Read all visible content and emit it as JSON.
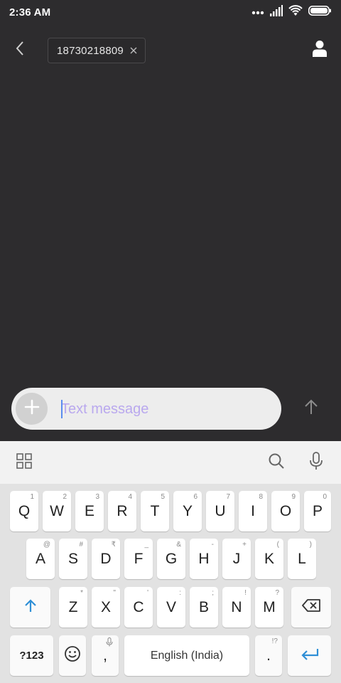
{
  "status_bar": {
    "time": "2:36 AM"
  },
  "header": {
    "recipient": "18730218809"
  },
  "compose": {
    "placeholder": "Text message"
  },
  "keyboard": {
    "row1": [
      {
        "label": "Q",
        "hint": "1"
      },
      {
        "label": "W",
        "hint": "2"
      },
      {
        "label": "E",
        "hint": "3"
      },
      {
        "label": "R",
        "hint": "4"
      },
      {
        "label": "T",
        "hint": "5"
      },
      {
        "label": "Y",
        "hint": "6"
      },
      {
        "label": "U",
        "hint": "7"
      },
      {
        "label": "I",
        "hint": "8"
      },
      {
        "label": "O",
        "hint": "9"
      },
      {
        "label": "P",
        "hint": "0"
      }
    ],
    "row2": [
      {
        "label": "A",
        "hint": "@"
      },
      {
        "label": "S",
        "hint": "#"
      },
      {
        "label": "D",
        "hint": "₹"
      },
      {
        "label": "F",
        "hint": "_"
      },
      {
        "label": "G",
        "hint": "&"
      },
      {
        "label": "H",
        "hint": "-"
      },
      {
        "label": "J",
        "hint": "+"
      },
      {
        "label": "K",
        "hint": "("
      },
      {
        "label": "L",
        "hint": ")"
      }
    ],
    "row3": [
      {
        "label": "Z",
        "hint": "*"
      },
      {
        "label": "X",
        "hint": "\""
      },
      {
        "label": "C",
        "hint": "'"
      },
      {
        "label": "V",
        "hint": ":"
      },
      {
        "label": "B",
        "hint": ";"
      },
      {
        "label": "N",
        "hint": "!"
      },
      {
        "label": "M",
        "hint": "?"
      }
    ],
    "symbols_label": "?123",
    "comma_label": ",",
    "space_label": "English (India)",
    "period_label": ".",
    "period_hint": "!?"
  }
}
